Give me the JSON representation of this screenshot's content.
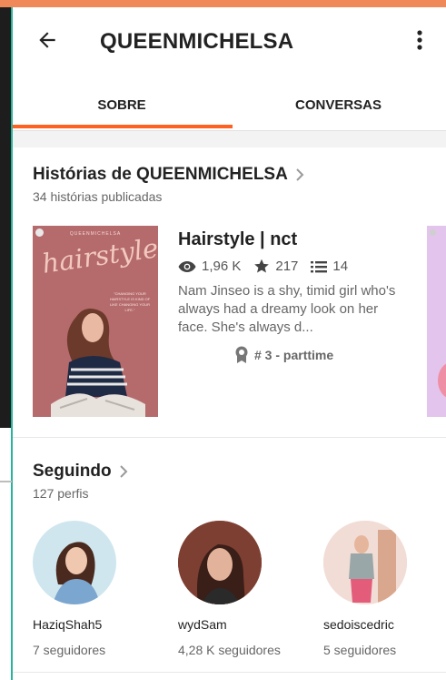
{
  "header": {
    "title": "QUEENMICHELSA"
  },
  "tabs": [
    {
      "label": "SOBRE",
      "active": true
    },
    {
      "label": "CONVERSAS",
      "active": false
    }
  ],
  "stories_section": {
    "title": "Histórias de QUEENMICHELSA",
    "subtitle": "34 histórias publicadas",
    "story": {
      "cover_author": "QUEENMICHELSA",
      "cover_word": "hairstyle",
      "cover_quote": "\"CHANGING YOUR HAIRSTYLE IS KIND OF LIKE CHANGING YOUR LIFE.\"",
      "title": "Hairstyle | nct",
      "views": "1,96 K",
      "votes": "217",
      "parts": "14",
      "description": "Nam Jinseo is a shy, timid girl who's always had a dreamy look on her face. She's always d...",
      "rank": "# 3 - parttime"
    }
  },
  "following_section": {
    "title": "Seguindo",
    "subtitle": "127 perfis",
    "profiles": [
      {
        "name": "HaziqShah5",
        "followers": "7 seguidores"
      },
      {
        "name": "wydSam",
        "followers": "4,28 K seguidores"
      },
      {
        "name": "sedoiscedric",
        "followers": "5 seguidores"
      }
    ]
  },
  "colors": {
    "accent": "#ff6122",
    "top_strip": "#f0895a",
    "side_line": "#2bb39a"
  }
}
